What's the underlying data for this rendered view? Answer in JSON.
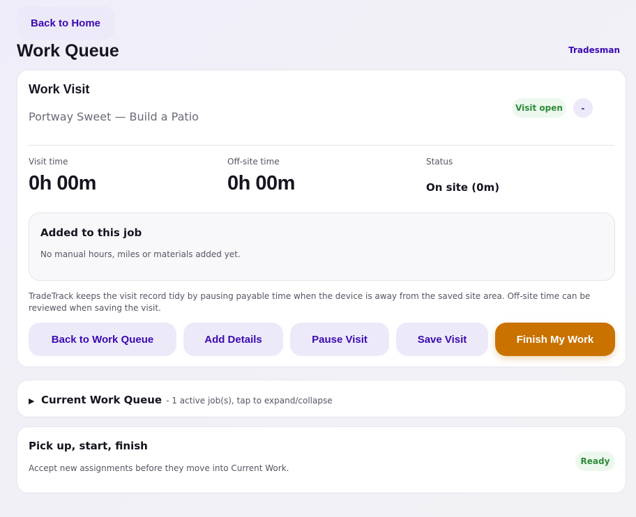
{
  "header": {
    "back_home_label": "Back to Home",
    "title": "Work Queue",
    "role": "Tradesman"
  },
  "visit": {
    "title": "Work Visit",
    "subtitle": "Portway Sweet — Build a Patio",
    "badge_status": "Visit open",
    "badge_extra": "-",
    "metrics": {
      "visit_time_label": "Visit time",
      "visit_time_value": "0h 00m",
      "offsite_time_label": "Off-site time",
      "offsite_time_value": "0h 00m",
      "status_label": "Status",
      "status_value": "On site (0m)"
    },
    "added": {
      "title": "Added to this job",
      "text": "No manual hours, miles or materials added yet."
    },
    "note": "TradeTrack keeps the visit record tidy by pausing payable time when the device is away from the saved site area. Off-site time can be reviewed when saving the visit.",
    "actions": {
      "back_to_queue": "Back to Work Queue",
      "add_details": "Add Details",
      "pause_visit": "Pause Visit",
      "save_visit": "Save Visit",
      "finish_work": "Finish My Work"
    }
  },
  "current_queue": {
    "title": "Current Work Queue",
    "hint": "- 1 active job(s), tap to expand/collapse"
  },
  "pickup": {
    "title": "Pick up, start, finish",
    "text": "Accept new assignments before they move into Current Work.",
    "badge": "Ready"
  },
  "colors": {
    "accent": "#3c09b3",
    "primary_button": "#c97200",
    "success": "#2e8b3a"
  }
}
